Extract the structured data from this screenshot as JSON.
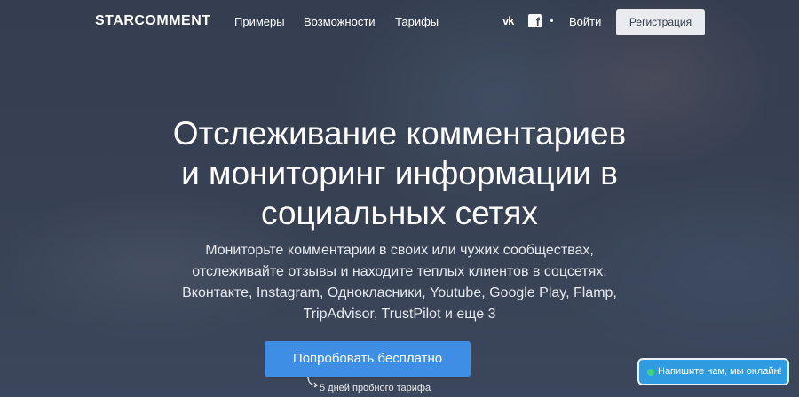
{
  "header": {
    "logo": "STARCOMMENT",
    "nav": [
      "Примеры",
      "Возможности",
      "Тарифы"
    ],
    "social": {
      "vk_icon": "vk-icon",
      "fb_icon": "facebook-icon"
    },
    "login": "Войти",
    "register": "Регистрация"
  },
  "hero": {
    "title_lines": [
      "Отслеживание комментариев",
      "и мониторинг информации в",
      "социальных сетях"
    ],
    "subtitle_lines": [
      "Мониторьте комментарии в своих или чужих сообществах,",
      "отслеживайте отзывы и находите теплых клиентов в соцсетях.",
      "Вконтакте, Instagram, Однокласники, Youtube, Google Play, Flamp,",
      "TripAdvisor, TrustPilot и еще 3"
    ],
    "cta": "Попробовать бесплатно",
    "trial_note": "5 дней пробного тарифа"
  },
  "chat": {
    "label": "Напишите нам, мы онлайн!",
    "status_color": "#3fd37c"
  },
  "colors": {
    "accent": "#3f8ee6",
    "chat": "#2f9be0",
    "register_bg": "#e9ebef"
  }
}
